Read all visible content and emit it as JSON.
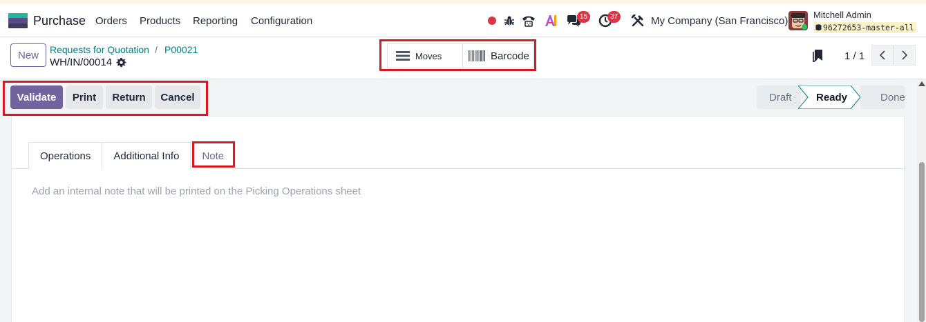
{
  "navbar": {
    "app_name": "Purchase",
    "menus": [
      "Orders",
      "Products",
      "Reporting",
      "Configuration"
    ],
    "chat_badge": "15",
    "activity_badge": "37",
    "company": "My Company (San Francisco)",
    "user_name": "Mitchell Admin",
    "db_name": "96272653-master-all",
    "icons": [
      "record-icon",
      "bug-icon",
      "phone-icon",
      "ai-icon",
      "chat-icon",
      "clock-icon",
      "tools-icon"
    ]
  },
  "control_panel": {
    "new_label": "New",
    "breadcrumb": [
      "Requests for Quotation",
      "P00021"
    ],
    "breadcrumb_sep": "/",
    "record_name": "WH/IN/00014",
    "smart_buttons": {
      "moves": "Moves",
      "barcode": "Barcode"
    },
    "pager": "1 / 1"
  },
  "actions": {
    "validate": "Validate",
    "print": "Print",
    "return": "Return",
    "cancel": "Cancel"
  },
  "statusbar": {
    "stages": [
      "Draft",
      "Ready",
      "Done"
    ],
    "active": "Ready"
  },
  "tabs": {
    "items": [
      "Operations",
      "Additional Info",
      "Note"
    ],
    "active": "Note"
  },
  "note": {
    "placeholder": "Add an internal note that will be printed on the Picking Operations sheet"
  },
  "colors": {
    "brand": "#71639e",
    "link": "#017e84",
    "highlight_box": "#d71920",
    "badge": "#dc3545"
  }
}
